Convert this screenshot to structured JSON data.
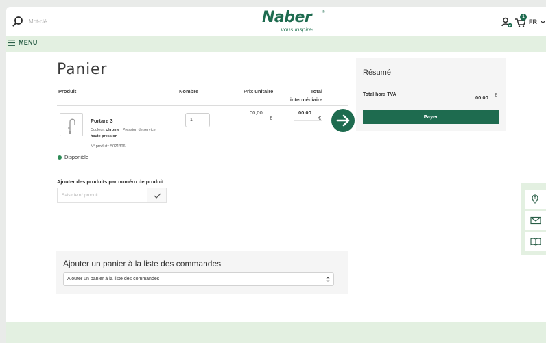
{
  "header": {
    "search_placeholder": "Mot-clé...",
    "logo_text": "Naber",
    "logo_tagline": "... vous inspire!",
    "cart_count": "1",
    "language": "FR",
    "menu_label": "MENU"
  },
  "cart": {
    "title": "Panier",
    "columns": {
      "product": "Produit",
      "quantity": "Nombre",
      "unit_price": "Prix unitaire",
      "subtotal": "Total intermédiaire"
    },
    "item": {
      "name": "Portare 3",
      "color_label": "Couleur:",
      "color_value": "chrome",
      "separator": "|",
      "pressure_label": "Pression de service:",
      "pressure_value": "haute pression",
      "product_number": "N° produit : 5021306",
      "quantity": "1",
      "unit_price": "00,00",
      "unit_currency": "€",
      "total_price": "00,00",
      "total_currency": "€",
      "availability": "Disponible"
    },
    "add_by_number": {
      "label": "Ajouter des produits par numéro de produit :",
      "placeholder": "Saisir le n° produit..."
    }
  },
  "summary": {
    "title": "Résumé",
    "total_label": "Total hors TVA",
    "total_value": "00,00",
    "currency": "€",
    "pay_label": "Payer"
  },
  "order_list": {
    "title": "Ajouter un panier à la liste des commandes",
    "select_value": "Ajouter un panier à la liste des commandes"
  },
  "side_tabs": {
    "location_icon": "location-pin-icon",
    "mail_icon": "envelope-icon",
    "catalog_icon": "open-book-icon"
  },
  "colors": {
    "brand_green": "#1e6b4f",
    "light_green": "#e3f0e1",
    "panel_gray": "#f5f5f5"
  }
}
